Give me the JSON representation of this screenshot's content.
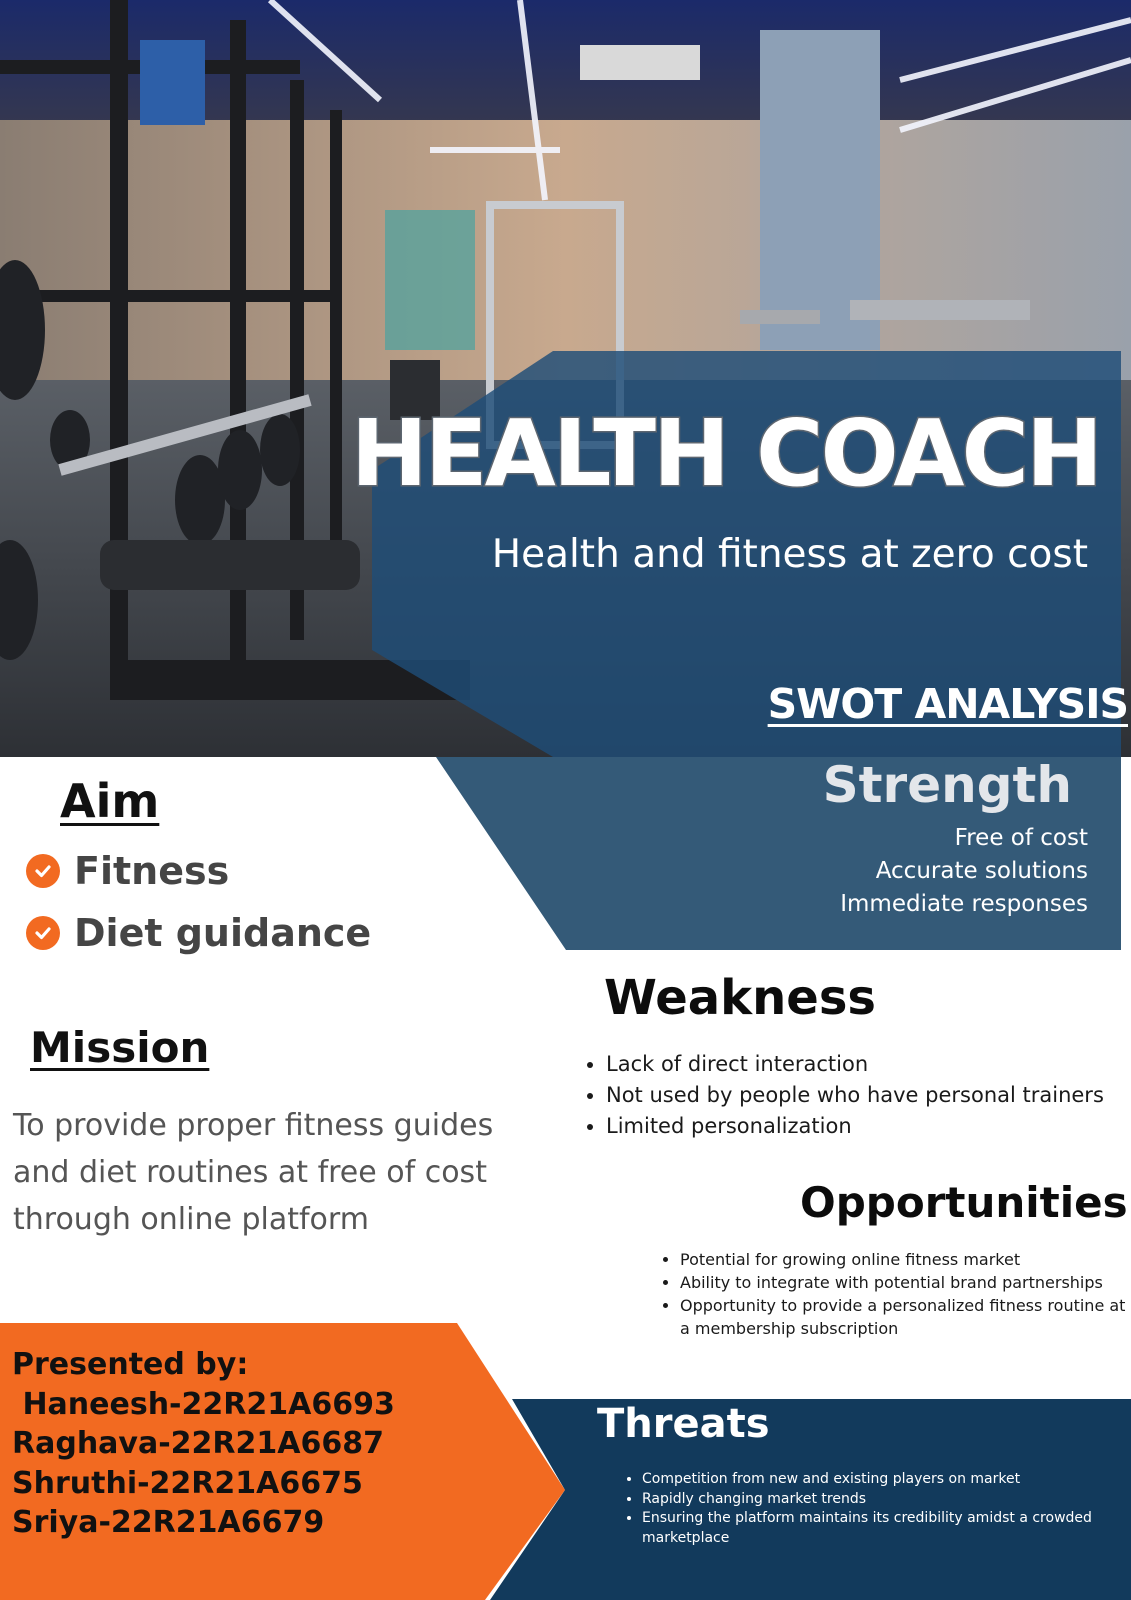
{
  "hero": {
    "title": "HEALTH COACH",
    "subtitle": "Health and fitness at zero cost",
    "swot_heading": "SWOT ANALYSIS"
  },
  "strength": {
    "heading": "Strength",
    "items": [
      "Free of cost",
      "Accurate solutions",
      "Immediate responses"
    ]
  },
  "aim": {
    "heading": "Aim",
    "items": [
      "Fitness",
      "Diet guidance"
    ]
  },
  "mission": {
    "heading": "Mission",
    "text": "To provide proper fitness guides and diet routines at free of cost through online platform"
  },
  "weakness": {
    "heading": "Weakness",
    "items": [
      "Lack of direct interaction",
      "Not  used by people who have personal trainers",
      "Limited personalization"
    ]
  },
  "opportunities": {
    "heading": "Opportunities",
    "items": [
      "Potential for growing online fitness market",
      "Ability to integrate with potential brand partnerships",
      "Opportunity to provide a personalized fitness routine at a membership subscription"
    ]
  },
  "presented": {
    "heading": "Presented by:",
    "names": [
      " Haneesh-22R21A6693",
      "Raghava-22R21A6687",
      "Shruthi-22R21A6675",
      "Sriya-22R21A6679"
    ]
  },
  "threats": {
    "heading": "Threats",
    "items": [
      "Competition from new and existing players on market",
      "Rapidly changing market trends",
      "Ensuring the platform maintains its credibility amidst a crowded marketplace"
    ]
  },
  "colors": {
    "panel_blue": "#1f4d78",
    "navy": "#123a5c",
    "orange": "#f26a21",
    "check_orange": "#f26a21"
  },
  "icons": {
    "aim_bullet": "check-circle-icon"
  }
}
